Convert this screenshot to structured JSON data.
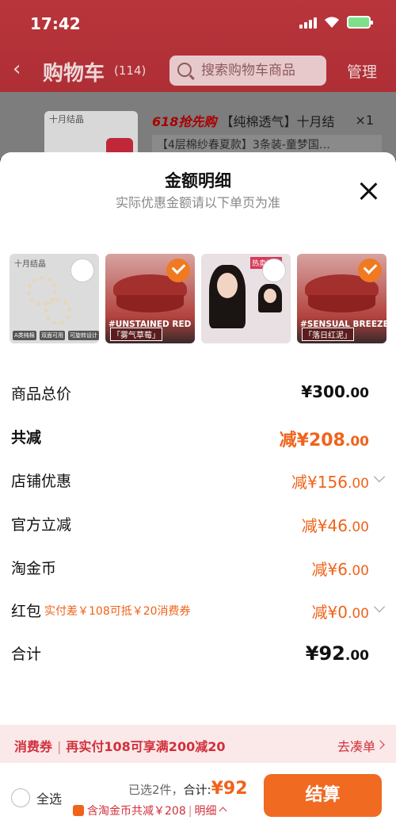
{
  "status_bar": {
    "time": "17:42"
  },
  "header": {
    "title": "购物车",
    "count": "(114)",
    "search_placeholder": "搜索购物车商品",
    "manage_label": "管理"
  },
  "background_cart_item": {
    "brand": "十月结晶",
    "promo": "618抢先购",
    "title": "【纯棉透气】十月结",
    "qty": "×1",
    "spec": "【4层棉纱春夏款】3条装-童梦国…"
  },
  "sheet": {
    "title": "金额明细",
    "subtitle": "实际优惠金额请以下单页为准"
  },
  "products": [
    {
      "brand": "十月结晶",
      "tags": [
        "A类纯棉",
        "双面可用",
        "可旋转设计"
      ],
      "selected": false
    },
    {
      "label": "#UNSTAINED RED",
      "sublabel": "「雾气草莓」",
      "selected": true
    },
    {
      "badge": "热卖推荐",
      "selected": false
    },
    {
      "label": "#SENSUAL BREEZE",
      "sublabel": "「落日红泥」",
      "selected": true
    }
  ],
  "rows": {
    "total_price": {
      "label": "商品总价",
      "currency": "¥",
      "int": "300",
      "dec": ".00"
    },
    "discount_total": {
      "label": "共减",
      "prefix": "减",
      "currency": "¥",
      "int": "208",
      "dec": ".00"
    },
    "shop_discount": {
      "label": "店铺优惠",
      "prefix": "减",
      "currency": "¥",
      "int": "156",
      "dec": ".00"
    },
    "official_discount": {
      "label": "官方立减",
      "prefix": "减",
      "currency": "¥",
      "int": "46",
      "dec": ".00"
    },
    "tao_coin": {
      "label": "淘金币",
      "prefix": "减",
      "currency": "¥",
      "int": "6",
      "dec": ".00"
    },
    "red_packet": {
      "label": "红包",
      "note": "实付差￥108可抵￥20消费券",
      "prefix": "减",
      "currency": "¥",
      "int": "0",
      "dec": ".00"
    },
    "grand_total": {
      "label": "合计",
      "currency": "¥",
      "int": "92",
      "dec": ".00"
    }
  },
  "banner": {
    "part1": "消费券",
    "separator": "|",
    "part2": "再实付108可享满200减20",
    "link": "去凑单"
  },
  "bottom_bar": {
    "select_all": "全选",
    "selected_summary": "已选2件，",
    "total_label": "合计:",
    "total_value": "¥92",
    "coin_note": "含淘金币共减￥208",
    "detail_link": "明细",
    "checkout_label": "结算"
  }
}
